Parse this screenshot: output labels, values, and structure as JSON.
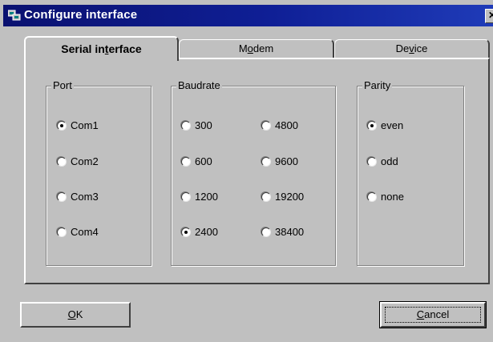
{
  "window": {
    "title": "Configure interface",
    "close_glyph": "✕"
  },
  "tabs": [
    {
      "label_pre": "Serial in",
      "label_u": "t",
      "label_post": "erface",
      "active": true
    },
    {
      "label_pre": "M",
      "label_u": "o",
      "label_post": "dem",
      "active": false
    },
    {
      "label_pre": "De",
      "label_u": "v",
      "label_post": "ice",
      "active": false
    }
  ],
  "port": {
    "label": "Port",
    "options": [
      "Com1",
      "Com2",
      "Com3",
      "Com4"
    ],
    "selected": "Com1"
  },
  "baudrate": {
    "label": "Baudrate",
    "options": [
      "300",
      "600",
      "1200",
      "2400",
      "4800",
      "9600",
      "19200",
      "38400"
    ],
    "selected": "2400"
  },
  "parity": {
    "label": "Parity",
    "options": [
      "even",
      "odd",
      "none"
    ],
    "selected": "even"
  },
  "buttons": {
    "ok_u": "O",
    "ok_post": "K",
    "cancel_u": "C",
    "cancel_post": "ancel"
  },
  "icons": {
    "app": "network-interface-icon"
  }
}
